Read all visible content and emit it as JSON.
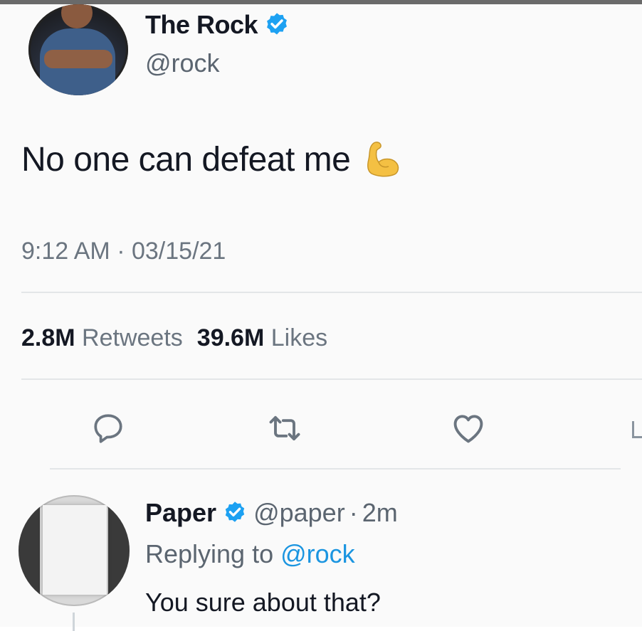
{
  "tweet": {
    "display_name": "The Rock",
    "handle": "@rock",
    "text": "No one can defeat me",
    "emoji_icon": "flexed-biceps-icon",
    "time": "9:12 AM",
    "separator": "·",
    "date": "03/15/21",
    "retweets_count": "2.8M",
    "retweets_label": "Retweets",
    "likes_count": "39.6M",
    "likes_label": "Likes",
    "actions": [
      "reply-icon",
      "retweet-icon",
      "like-icon",
      "share-icon"
    ]
  },
  "reply": {
    "display_name": "Paper",
    "handle": "@paper",
    "separator": "·",
    "age": "2m",
    "replying_prefix": "Replying to",
    "replying_to": "@rock",
    "text": "You sure about that?"
  },
  "colors": {
    "verified_blue": "#1da1f2",
    "text_primary": "#141823",
    "text_secondary": "#6b7580",
    "link_blue": "#1b95e0",
    "divider": "#e3e6e8"
  }
}
